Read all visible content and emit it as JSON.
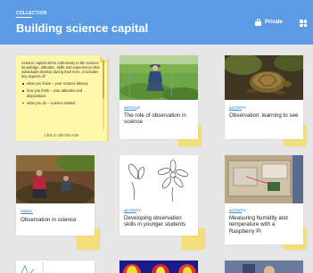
{
  "header": {
    "kicker": "COLLECTION",
    "title": "Building science capital",
    "privacy_label": "Private",
    "colors": {
      "bar": "#5b9be6",
      "text": "#ffffff"
    }
  },
  "note": {
    "body": "Science capital refers collectively to the science-knowledge, attitudes, skills and experiences that individuals develop during their lives. It includes key aspects of:",
    "bullets": [
      "what you know – your science literacy",
      "how you think – your attitudes and dispositions",
      "what you do – science-related"
    ],
    "cta": "Click to edit this note",
    "color": "#fff8a8"
  },
  "cards": [
    {
      "type": "ARTICLE",
      "title": "The role of observation in science",
      "image_icon": "field-researcher-photo"
    },
    {
      "type": "ACTIVITY",
      "title": "Observation: learning to see",
      "image_icon": "turtle-photo"
    },
    {
      "type": "VIDEO",
      "title": "Observation in science",
      "image_icon": "outdoor-students-photo"
    },
    {
      "type": "ACTIVITY",
      "title": "Developing observation skills in younger students",
      "image_icon": "flower-sketch"
    },
    {
      "type": "ACTIVITY",
      "title": "Measuring humidity and temperature with a Raspberry Pi",
      "image_icon": "sensor-box-photo"
    }
  ],
  "accent": "#3b8ad9",
  "stack_color": "#f3df7a"
}
